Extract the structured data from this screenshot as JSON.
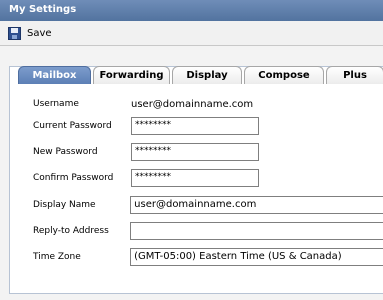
{
  "window": {
    "title": "My Settings"
  },
  "toolbar": {
    "save_label": "Save"
  },
  "tabs": [
    {
      "label": "Mailbox",
      "active": true
    },
    {
      "label": "Forwarding",
      "active": false
    },
    {
      "label": "Display",
      "active": false
    },
    {
      "label": "Compose",
      "active": false
    },
    {
      "label": "Plus",
      "active": false
    }
  ],
  "form": {
    "username": {
      "label": "Username",
      "value": "user@domainname.com"
    },
    "current_password": {
      "label": "Current Password",
      "value": "********"
    },
    "new_password": {
      "label": "New Password",
      "value": "********"
    },
    "confirm_password": {
      "label": "Confirm Password",
      "value": "********"
    },
    "display_name": {
      "label": "Display Name",
      "value": "user@domainname.com"
    },
    "reply_to": {
      "label": "Reply-to Address",
      "value": ""
    },
    "time_zone": {
      "label": "Time Zone",
      "value": "(GMT-05:00) Eastern Time (US & Canada)"
    }
  }
}
